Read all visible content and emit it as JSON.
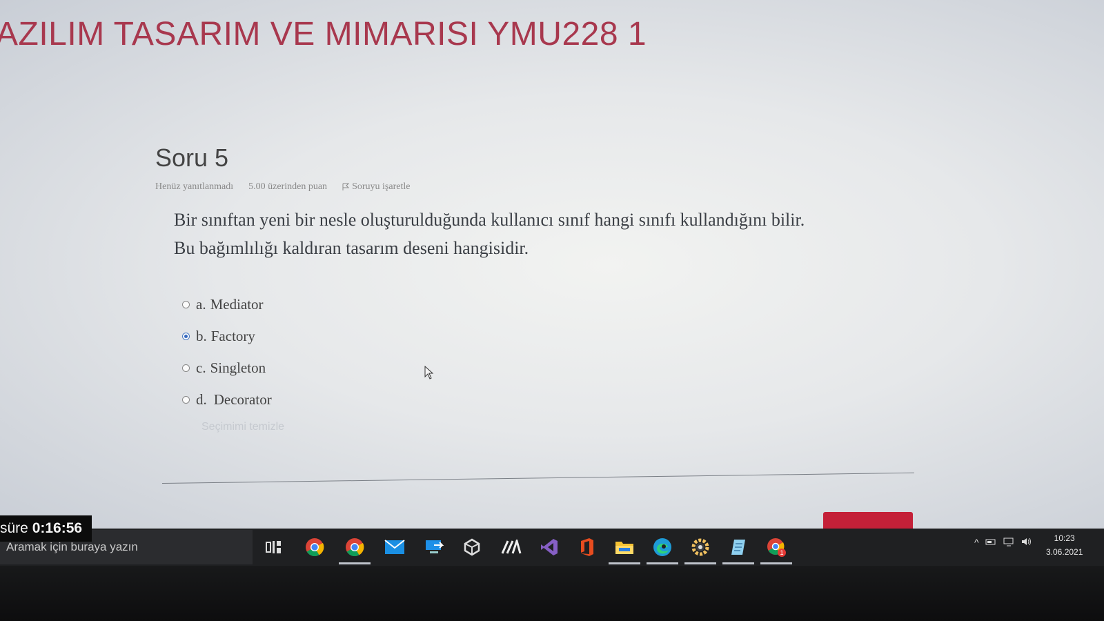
{
  "page": {
    "course_title": "AZILIM TASARIM VE MIMARISI YMU228 1"
  },
  "question": {
    "heading": "Soru 5",
    "status": "Henüz yanıtlanmadı",
    "points": "5.00 üzerinden puan",
    "flag_label": "Soruyu işaretle",
    "text_line1": "Bir sınıftan yeni bir nesle oluşturulduğunda kullanıcı sınıf hangi sınıfı kullandığını bilir.",
    "text_line2": "Bu bağımlılığı kaldıran tasarım deseni hangisidir.",
    "answers": [
      {
        "letter": "a.",
        "label": "Mediator",
        "selected": false
      },
      {
        "letter": "b.",
        "label": "Factory",
        "selected": true
      },
      {
        "letter": "c.",
        "label": "Singleton",
        "selected": false
      },
      {
        "letter": "d.",
        "label": "Decorator",
        "selected": false
      }
    ],
    "clear_choice": "Seçimimi temizle"
  },
  "timer": {
    "label": "süre",
    "value": "0:16:56"
  },
  "taskbar": {
    "search_placeholder": "Aramak için buraya yazın",
    "icons": [
      "task-view-icon",
      "chrome-icon",
      "chrome-profile-icon",
      "mail-icon",
      "remote-desktop-icon",
      "unity-icon",
      "mathtype-icon",
      "visual-studio-icon",
      "office-icon",
      "file-explorer-icon",
      "edge-icon",
      "settings-icon",
      "notepad-icon",
      "chrome-notification-icon"
    ],
    "time": "10:23",
    "date": "3.06.2021"
  },
  "colors": {
    "title": "#a8384e",
    "accent_button": "#c42038",
    "radio_selected": "#3468c0"
  }
}
